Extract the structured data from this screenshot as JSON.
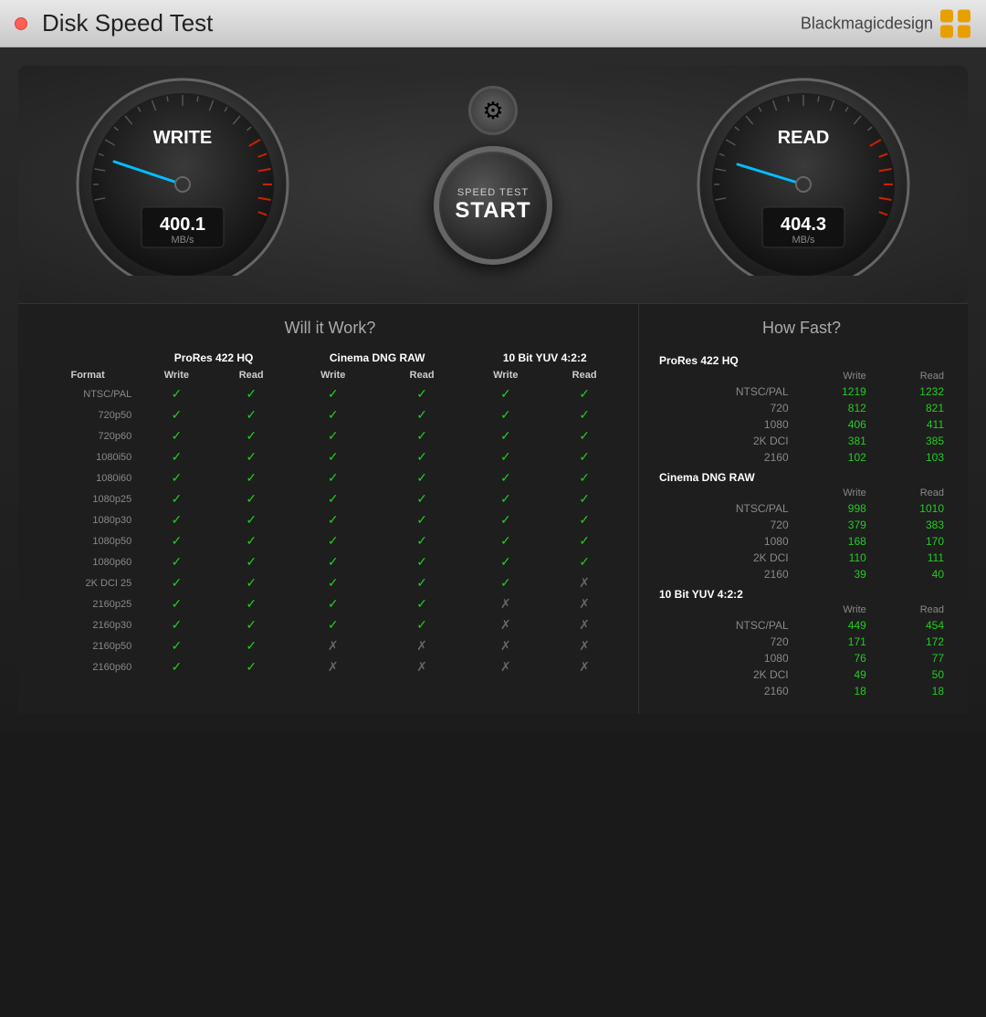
{
  "titlebar": {
    "title": "Disk Speed Test",
    "brand_name": "Blackmagicdesign"
  },
  "gauges": {
    "write": {
      "label": "WRITE",
      "value": "400.1",
      "unit": "MB/s"
    },
    "read": {
      "label": "READ",
      "value": "404.3",
      "unit": "MB/s"
    }
  },
  "start_button": {
    "line1": "SPEED TEST",
    "line2": "START"
  },
  "left_section_title": "Will it Work?",
  "right_section_title": "How Fast?",
  "compat_headers": {
    "groups": [
      "ProRes 422 HQ",
      "Cinema DNG RAW",
      "10 Bit YUV 4:2:2"
    ],
    "sub": [
      "Write",
      "Read",
      "Write",
      "Read",
      "Write",
      "Read"
    ],
    "format": "Format"
  },
  "compat_rows": [
    {
      "label": "NTSC/PAL",
      "vals": [
        1,
        1,
        1,
        1,
        1,
        1
      ]
    },
    {
      "label": "720p50",
      "vals": [
        1,
        1,
        1,
        1,
        1,
        1
      ]
    },
    {
      "label": "720p60",
      "vals": [
        1,
        1,
        1,
        1,
        1,
        1
      ]
    },
    {
      "label": "1080i50",
      "vals": [
        1,
        1,
        1,
        1,
        1,
        1
      ]
    },
    {
      "label": "1080i60",
      "vals": [
        1,
        1,
        1,
        1,
        1,
        1
      ]
    },
    {
      "label": "1080p25",
      "vals": [
        1,
        1,
        1,
        1,
        1,
        1
      ]
    },
    {
      "label": "1080p30",
      "vals": [
        1,
        1,
        1,
        1,
        1,
        1
      ]
    },
    {
      "label": "1080p50",
      "vals": [
        1,
        1,
        1,
        1,
        1,
        1
      ]
    },
    {
      "label": "1080p60",
      "vals": [
        1,
        1,
        1,
        1,
        1,
        1
      ]
    },
    {
      "label": "2K DCI 25",
      "vals": [
        1,
        1,
        1,
        1,
        1,
        0
      ]
    },
    {
      "label": "2160p25",
      "vals": [
        1,
        1,
        1,
        1,
        0,
        0
      ]
    },
    {
      "label": "2160p30",
      "vals": [
        1,
        1,
        1,
        1,
        0,
        0
      ]
    },
    {
      "label": "2160p50",
      "vals": [
        1,
        1,
        0,
        0,
        0,
        0
      ]
    },
    {
      "label": "2160p60",
      "vals": [
        1,
        1,
        0,
        0,
        0,
        0
      ]
    }
  ],
  "speed_groups": [
    {
      "name": "ProRes 422 HQ",
      "rows": [
        {
          "label": "NTSC/PAL",
          "write": "1219",
          "read": "1232"
        },
        {
          "label": "720",
          "write": "812",
          "read": "821"
        },
        {
          "label": "1080",
          "write": "406",
          "read": "411"
        },
        {
          "label": "2K DCI",
          "write": "381",
          "read": "385"
        },
        {
          "label": "2160",
          "write": "102",
          "read": "103"
        }
      ]
    },
    {
      "name": "Cinema DNG RAW",
      "rows": [
        {
          "label": "NTSC/PAL",
          "write": "998",
          "read": "1010"
        },
        {
          "label": "720",
          "write": "379",
          "read": "383"
        },
        {
          "label": "1080",
          "write": "168",
          "read": "170"
        },
        {
          "label": "2K DCI",
          "write": "110",
          "read": "111"
        },
        {
          "label": "2160",
          "write": "39",
          "read": "40"
        }
      ]
    },
    {
      "name": "10 Bit YUV 4:2:2",
      "rows": [
        {
          "label": "NTSC/PAL",
          "write": "449",
          "read": "454"
        },
        {
          "label": "720",
          "write": "171",
          "read": "172"
        },
        {
          "label": "1080",
          "write": "76",
          "read": "77"
        },
        {
          "label": "2K DCI",
          "write": "49",
          "read": "50"
        },
        {
          "label": "2160",
          "write": "18",
          "read": "18"
        }
      ]
    }
  ]
}
